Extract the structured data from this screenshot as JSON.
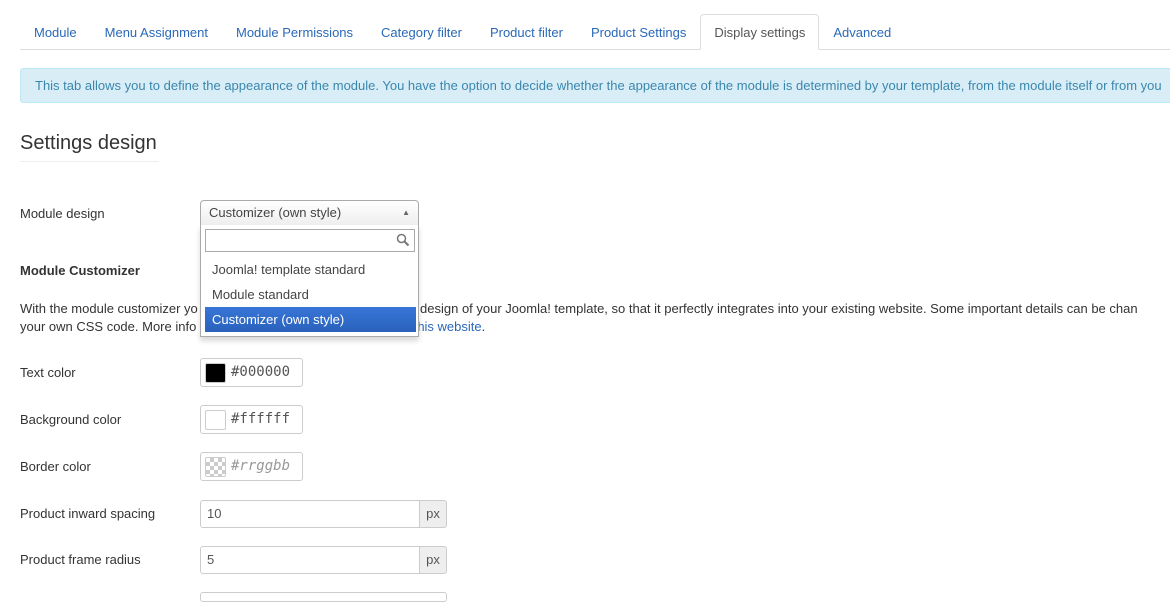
{
  "tabs": [
    {
      "label": "Module",
      "active": false
    },
    {
      "label": "Menu Assignment",
      "active": false
    },
    {
      "label": "Module Permissions",
      "active": false
    },
    {
      "label": "Category filter",
      "active": false
    },
    {
      "label": "Product filter",
      "active": false
    },
    {
      "label": "Product Settings",
      "active": false
    },
    {
      "label": "Display settings",
      "active": true
    },
    {
      "label": "Advanced",
      "active": false
    }
  ],
  "info_text": "This tab allows you to define the appearance of the module. You have the option to decide whether the appearance of the module is determined by your template, from the module itself or from you",
  "section_title": "Settings design",
  "module_design": {
    "label": "Module design",
    "selected": "Customizer (own style)",
    "search_value": "",
    "options": [
      "Joomla! template standard",
      "Module standard",
      "Customizer (own style)"
    ],
    "selected_index": 2
  },
  "customizer": {
    "heading": "Module Customizer",
    "desc_line1_start": "With the module customizer yo",
    "desc_line1_end": " the design of your Joomla! template, so that it perfectly integrates into your existing website. Some important details can be chan",
    "desc_line2_start": "your own CSS code. More info",
    "desc_link": "his website",
    "desc_line2_end": "."
  },
  "fields": {
    "text_color": {
      "label": "Text color",
      "value": "#000000",
      "swatch": "#000000"
    },
    "background_color": {
      "label": "Background color",
      "value": "#ffffff",
      "swatch": "#ffffff"
    },
    "border_color": {
      "label": "Border color",
      "placeholder": "#rrggbb"
    },
    "inward_spacing": {
      "label": "Product inward spacing",
      "value": "10",
      "unit": "px"
    },
    "frame_radius": {
      "label": "Product frame radius",
      "value": "5",
      "unit": "px"
    }
  },
  "colors": {
    "link": "#2a69b8",
    "info_bg": "#d9edf7",
    "info_text": "#3a87ad",
    "selected_option": "#3875d7"
  }
}
